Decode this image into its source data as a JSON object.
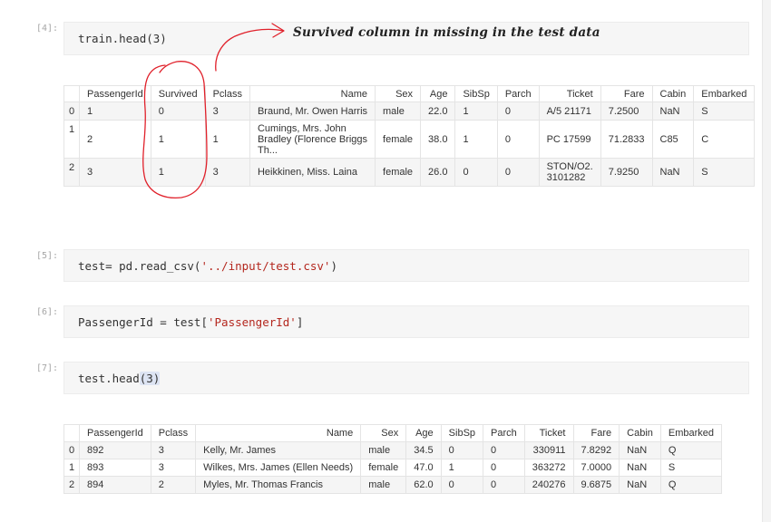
{
  "cells": [
    {
      "prompt": "[4]:",
      "code": "train.head(3)"
    },
    {
      "prompt": "[5]:",
      "code_prefix": "test= pd.read_csv(",
      "code_string": "'../input/test.csv'",
      "code_suffix": ")"
    },
    {
      "prompt": "[6]:",
      "code_prefix": "PassengerId = test[",
      "code_string": "'PassengerId'",
      "code_suffix": "]"
    },
    {
      "prompt": "[7]:",
      "code_prefix": "test.head",
      "code_paren": "(3)"
    }
  ],
  "annotation": {
    "text": "Survived column in missing in the test data",
    "ink_color": "#e0202a"
  },
  "train_table": {
    "columns": [
      "PassengerId",
      "Survived",
      "Pclass",
      "Name",
      "Sex",
      "Age",
      "SibSp",
      "Parch",
      "Ticket",
      "Fare",
      "Cabin",
      "Embarked"
    ],
    "rows": [
      {
        "index": "0",
        "cells": [
          "1",
          "0",
          "3",
          "Braund, Mr. Owen Harris",
          "male",
          "22.0",
          "1",
          "0",
          "A/5 21171",
          "7.2500",
          "NaN",
          "S"
        ]
      },
      {
        "index": "1",
        "cells": [
          "2",
          "1",
          "1",
          "Cumings, Mrs. John Bradley (Florence Briggs Th...",
          "female",
          "38.0",
          "1",
          "0",
          "PC 17599",
          "71.2833",
          "C85",
          "C"
        ]
      },
      {
        "index": "2",
        "cells": [
          "3",
          "1",
          "3",
          "Heikkinen, Miss. Laina",
          "female",
          "26.0",
          "0",
          "0",
          "STON/O2. 3101282",
          "7.9250",
          "NaN",
          "S"
        ]
      }
    ]
  },
  "test_table": {
    "columns": [
      "PassengerId",
      "Pclass",
      "Name",
      "Sex",
      "Age",
      "SibSp",
      "Parch",
      "Ticket",
      "Fare",
      "Cabin",
      "Embarked"
    ],
    "rows": [
      {
        "index": "0",
        "cells": [
          "892",
          "3",
          "Kelly, Mr. James",
          "male",
          "34.5",
          "0",
          "0",
          "330911",
          "7.8292",
          "NaN",
          "Q"
        ]
      },
      {
        "index": "1",
        "cells": [
          "893",
          "3",
          "Wilkes, Mrs. James (Ellen Needs)",
          "female",
          "47.0",
          "1",
          "0",
          "363272",
          "7.0000",
          "NaN",
          "S"
        ]
      },
      {
        "index": "2",
        "cells": [
          "894",
          "2",
          "Myles, Mr. Thomas Francis",
          "male",
          "62.0",
          "0",
          "0",
          "240276",
          "9.6875",
          "NaN",
          "Q"
        ]
      }
    ]
  }
}
